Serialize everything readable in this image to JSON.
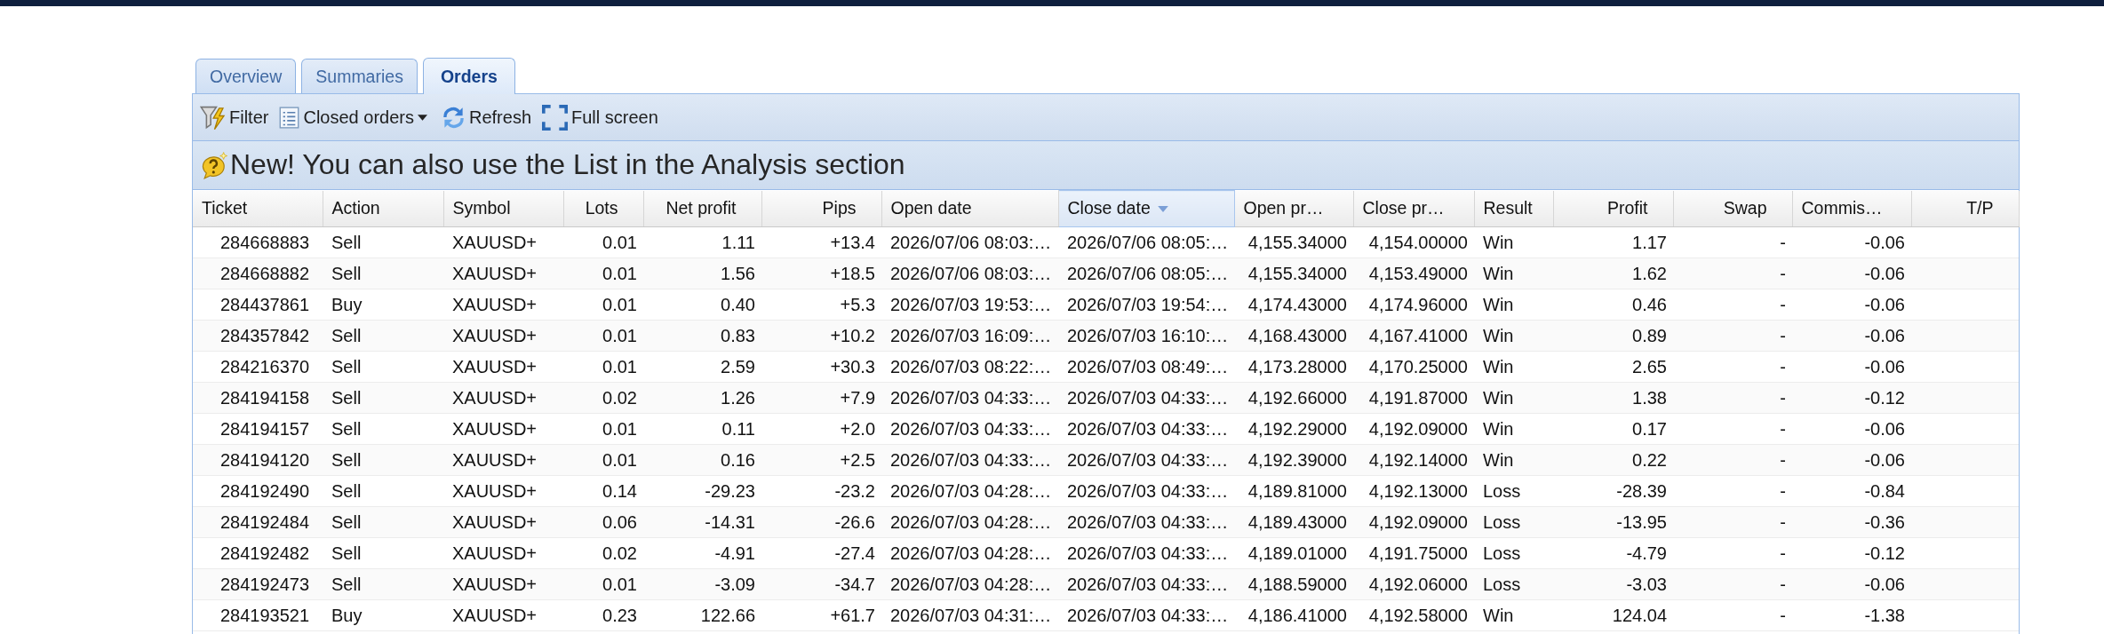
{
  "tabs": [
    {
      "label": "Overview",
      "selected": false
    },
    {
      "label": "Summaries",
      "selected": false
    },
    {
      "label": "Orders",
      "selected": true
    }
  ],
  "toolbar": [
    {
      "label": "Filter",
      "kind": "button"
    },
    {
      "label": "Closed orders",
      "kind": "menu"
    },
    {
      "label": "Refresh",
      "kind": "button"
    },
    {
      "label": "Full screen",
      "kind": "button"
    }
  ],
  "notice": {
    "text": "New! You can also use the List in the Analysis section"
  },
  "table": {
    "columns": [
      {
        "label": "Ticket",
        "kind": "figure",
        "sorted": false
      },
      {
        "label": "Action",
        "kind": "text",
        "sorted": false
      },
      {
        "label": "Symbol",
        "kind": "text",
        "sorted": false
      },
      {
        "label": "Lots",
        "kind": "number",
        "sorted": false
      },
      {
        "label": "Net profit",
        "kind": "number",
        "sorted": false
      },
      {
        "label": "Pips",
        "kind": "number",
        "sorted": false
      },
      {
        "label": "Open date",
        "kind": "text",
        "sorted": false
      },
      {
        "label": "Close date",
        "kind": "text",
        "sorted": true
      },
      {
        "label": "Open pr…",
        "kind": "figure",
        "sorted": false
      },
      {
        "label": "Close pr…",
        "kind": "figure",
        "sorted": false
      },
      {
        "label": "Result",
        "kind": "text",
        "sorted": false
      },
      {
        "label": "Profit",
        "kind": "number",
        "sorted": false
      },
      {
        "label": "Swap",
        "kind": "number",
        "sorted": false
      },
      {
        "label": "Commis…",
        "kind": "figure",
        "sorted": false
      },
      {
        "label": "T/P",
        "kind": "number",
        "sorted": false
      }
    ],
    "rows": [
      [
        "284668883",
        "Sell",
        "XAUUSD+",
        "0.01",
        "1.11",
        "+13.4",
        "2026/07/06 08:03:…",
        "2026/07/06 08:05:…",
        "4,155.34000",
        "4,154.00000",
        "Win",
        "1.17",
        "-",
        "-0.06"
      ],
      [
        "284668882",
        "Sell",
        "XAUUSD+",
        "0.01",
        "1.56",
        "+18.5",
        "2026/07/06 08:03:…",
        "2026/07/06 08:05:…",
        "4,155.34000",
        "4,153.49000",
        "Win",
        "1.62",
        "-",
        "-0.06"
      ],
      [
        "284437861",
        "Buy",
        "XAUUSD+",
        "0.01",
        "0.40",
        "+5.3",
        "2026/07/03 19:53:…",
        "2026/07/03 19:54:…",
        "4,174.43000",
        "4,174.96000",
        "Win",
        "0.46",
        "-",
        "-0.06"
      ],
      [
        "284357842",
        "Sell",
        "XAUUSD+",
        "0.01",
        "0.83",
        "+10.2",
        "2026/07/03 16:09:…",
        "2026/07/03 16:10:…",
        "4,168.43000",
        "4,167.41000",
        "Win",
        "0.89",
        "-",
        "-0.06"
      ],
      [
        "284216370",
        "Sell",
        "XAUUSD+",
        "0.01",
        "2.59",
        "+30.3",
        "2026/07/03 08:22:…",
        "2026/07/03 08:49:…",
        "4,173.28000",
        "4,170.25000",
        "Win",
        "2.65",
        "-",
        "-0.06"
      ],
      [
        "284194158",
        "Sell",
        "XAUUSD+",
        "0.02",
        "1.26",
        "+7.9",
        "2026/07/03 04:33:…",
        "2026/07/03 04:33:…",
        "4,192.66000",
        "4,191.87000",
        "Win",
        "1.38",
        "-",
        "-0.12"
      ],
      [
        "284194157",
        "Sell",
        "XAUUSD+",
        "0.01",
        "0.11",
        "+2.0",
        "2026/07/03 04:33:…",
        "2026/07/03 04:33:…",
        "4,192.29000",
        "4,192.09000",
        "Win",
        "0.17",
        "-",
        "-0.06"
      ],
      [
        "284194120",
        "Sell",
        "XAUUSD+",
        "0.01",
        "0.16",
        "+2.5",
        "2026/07/03 04:33:…",
        "2026/07/03 04:33:…",
        "4,192.39000",
        "4,192.14000",
        "Win",
        "0.22",
        "-",
        "-0.06"
      ],
      [
        "284192490",
        "Sell",
        "XAUUSD+",
        "0.14",
        "-29.23",
        "-23.2",
        "2026/07/03 04:28:…",
        "2026/07/03 04:33:…",
        "4,189.81000",
        "4,192.13000",
        "Loss",
        "-28.39",
        "-",
        "-0.84"
      ],
      [
        "284192484",
        "Sell",
        "XAUUSD+",
        "0.06",
        "-14.31",
        "-26.6",
        "2026/07/03 04:28:…",
        "2026/07/03 04:33:…",
        "4,189.43000",
        "4,192.09000",
        "Loss",
        "-13.95",
        "-",
        "-0.36"
      ],
      [
        "284192482",
        "Sell",
        "XAUUSD+",
        "0.02",
        "-4.91",
        "-27.4",
        "2026/07/03 04:28:…",
        "2026/07/03 04:33:…",
        "4,189.01000",
        "4,191.75000",
        "Loss",
        "-4.79",
        "-",
        "-0.12"
      ],
      [
        "284192473",
        "Sell",
        "XAUUSD+",
        "0.01",
        "-3.09",
        "-34.7",
        "2026/07/03 04:28:…",
        "2026/07/03 04:33:…",
        "4,188.59000",
        "4,192.06000",
        "Loss",
        "-3.03",
        "-",
        "-0.06"
      ],
      [
        "284193521",
        "Buy",
        "XAUUSD+",
        "0.23",
        "122.66",
        "+61.7",
        "2026/07/03 04:31:…",
        "2026/07/03 04:33:…",
        "4,186.41000",
        "4,192.58000",
        "Win",
        "124.04",
        "-",
        "-1.38"
      ]
    ]
  }
}
